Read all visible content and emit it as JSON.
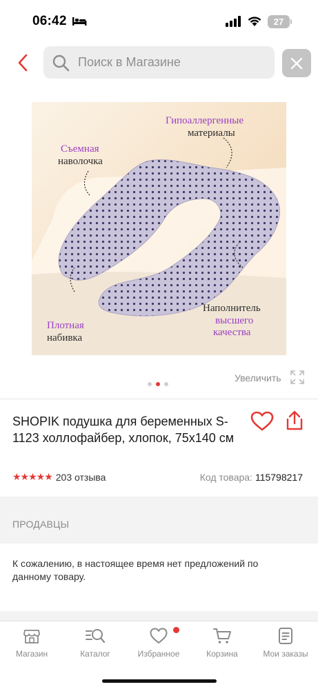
{
  "status_bar": {
    "time": "06:42",
    "battery": "27",
    "icons": [
      "bed-icon",
      "signal-icon",
      "wifi-icon",
      "battery-icon"
    ]
  },
  "header": {
    "search_placeholder": "Поиск в Магазине",
    "icons": [
      "chevron-left-icon",
      "search-icon",
      "close-icon"
    ],
    "accent_color": "#e53935"
  },
  "product_image": {
    "labels": {
      "removable_1": "Съемная",
      "removable_2": "наволочка",
      "hypo_1": "Гипоаллергенные",
      "hypo_2": "материалы",
      "dense_1": "Плотная",
      "dense_2": "набивка",
      "filler_1": "Наполнитель",
      "filler_2": "высшего",
      "filler_3": "качества"
    },
    "zoom_label": "Увеличить",
    "carousel": {
      "total": 3,
      "active": 2
    }
  },
  "product": {
    "title": "SHOPIK подушка для беременных S-1123 холлофайбер, хлопок, 75х140 см",
    "rating_stars": "★★★★★",
    "rating_value": 5,
    "reviews": "203 отзыва",
    "code_label": "Код товара:",
    "code_value": "115798217"
  },
  "sellers": {
    "title": "ПРОДАВЦЫ",
    "message": "К сожалению, в настоящее время нет предложений по данному товару."
  },
  "bottom_nav": {
    "items": [
      {
        "label": "Магазин",
        "icon": "store-icon"
      },
      {
        "label": "Каталог",
        "icon": "catalog-search-icon"
      },
      {
        "label": "Избранное",
        "icon": "heart-icon",
        "badge": true
      },
      {
        "label": "Корзина",
        "icon": "cart-icon"
      },
      {
        "label": "Мои заказы",
        "icon": "orders-icon"
      }
    ]
  }
}
